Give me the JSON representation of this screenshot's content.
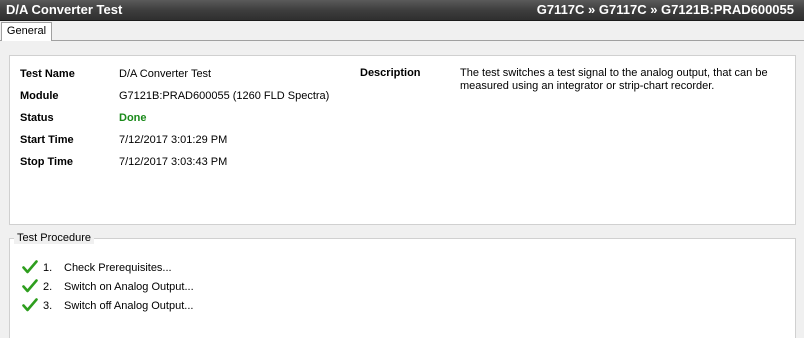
{
  "window": {
    "title": "D/A Converter Test",
    "breadcrumb": "G7117C » G7117C » G7121B:PRAD600055"
  },
  "tabs": [
    {
      "label": "General",
      "selected": true
    }
  ],
  "info": {
    "test_name": {
      "label": "Test Name",
      "value": "D/A Converter Test"
    },
    "module": {
      "label": "Module",
      "value": "G7121B:PRAD600055 (1260 FLD Spectra)"
    },
    "status": {
      "label": "Status",
      "value": "Done"
    },
    "start_time": {
      "label": "Start Time",
      "value": "7/12/2017 3:01:29 PM"
    },
    "stop_time": {
      "label": "Stop Time",
      "value": "7/12/2017 3:03:43 PM"
    },
    "description": {
      "label": "Description",
      "value": "The test switches a test signal to the analog output, that can be measured using an integrator or strip-chart recorder."
    }
  },
  "procedure": {
    "title": "Test Procedure",
    "steps": [
      {
        "number": "1.",
        "label": "Check Prerequisites...",
        "icon": "check-icon"
      },
      {
        "number": "2.",
        "label": "Switch on Analog Output...",
        "icon": "check-icon"
      },
      {
        "number": "3.",
        "label": "Switch off Analog Output...",
        "icon": "check-icon"
      }
    ]
  },
  "colors": {
    "status_done": "#1a8a1a",
    "check": "#2e9e1e",
    "titlebar": "#3e3e3e"
  }
}
